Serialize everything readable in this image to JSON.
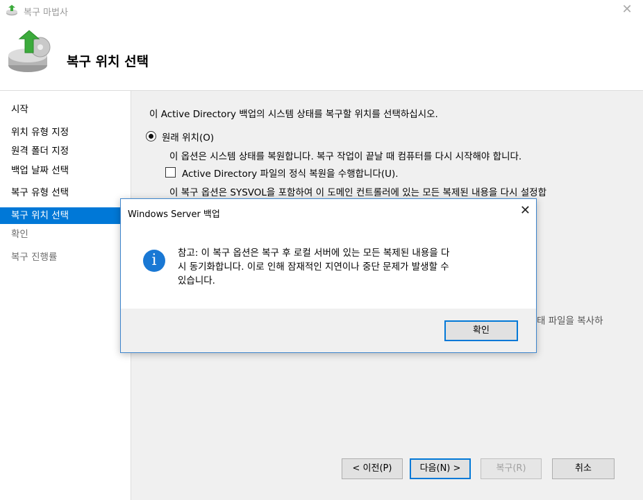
{
  "window": {
    "title": "복구 마법사"
  },
  "header": {
    "heading": "복구 위치 선택"
  },
  "sidebar": {
    "items": [
      {
        "label": "시작",
        "state": "normal"
      },
      {
        "label": "위치 유형 지정",
        "state": "normal"
      },
      {
        "label": "원격 폴더 지정",
        "state": "normal"
      },
      {
        "label": "백업 날짜 선택",
        "state": "normal"
      },
      {
        "label": "복구 유형 선택",
        "state": "normal"
      },
      {
        "label": "복구 위치 선택",
        "state": "active"
      },
      {
        "label": "확인",
        "state": "disabled"
      },
      {
        "label": "복구 진행률",
        "state": "disabled"
      }
    ]
  },
  "main": {
    "intro": "이 Active Directory 백업의 시스템 상태를 복구할 위치를 선택하십시오.",
    "original_location": {
      "label": "원래 위치(O)",
      "selected": true,
      "description": "이 옵션은 시스템 상태를 복원합니다. 복구 작업이 끝날 때 컴퓨터를 다시 시작해야 합니다.",
      "authoritative_checkbox": {
        "label": "Active Directory 파일의 정식 복원을 수행합니다(U).",
        "checked": false
      },
      "note": "이 복구 옵션은 SYSVOL을 포함하여 이 도메인 컨트롤러에 있는 모든 복제된 내용을 다시 설정합"
    },
    "partial_text": "태 파일을 복사하"
  },
  "buttons": {
    "back": "< 이전(P)",
    "next": "다음(N) >",
    "recover": "복구(R)",
    "cancel": "취소"
  },
  "dialog": {
    "title": "Windows Server 백업",
    "close": "✕",
    "message_lines": [
      "참고: 이 복구 옵션은 복구 후 로컬 서버에 있는 모든 복제된 내용을 다",
      "시 동기화합니다. 이로 인해 잠재적인 지연이나 중단 문제가 발생할 수",
      "있습니다."
    ],
    "ok": "확인"
  },
  "colors": {
    "accent": "#0078d7",
    "info_icon": "#1978d4",
    "content_bg": "#f0f0f0"
  }
}
